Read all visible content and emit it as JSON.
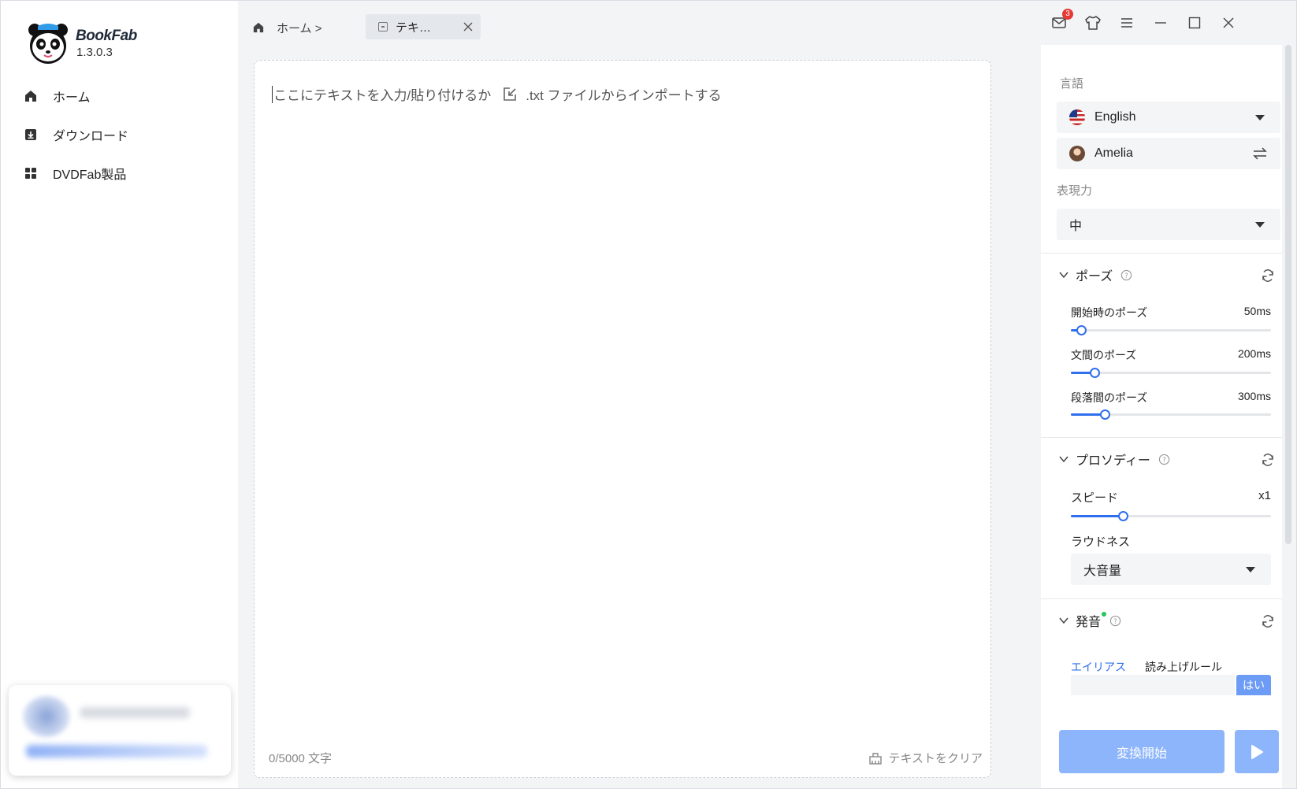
{
  "app": {
    "name": "BookFab",
    "version": "1.3.0.3"
  },
  "sidebar": {
    "items": [
      {
        "label": "ホーム",
        "icon": "home-icon"
      },
      {
        "label": "ダウンロード",
        "icon": "download-icon"
      },
      {
        "label": "DVDFab製品",
        "icon": "grid-icon"
      }
    ]
  },
  "header": {
    "breadcrumb": "ホーム >",
    "tab_label": "テキ…",
    "notification_count": "3",
    "icons": [
      "mail-icon",
      "shirt-icon",
      "menu-icon",
      "minimize-icon",
      "maximize-icon",
      "close-icon"
    ]
  },
  "editor": {
    "placeholder_text": "ここにテキストを入力/貼り付けるか",
    "import_text": ".txt ファイルからインポートする",
    "char_count": "0/5000 文字",
    "clear_label": "テキストをクリア"
  },
  "panel": {
    "language_label": "言語",
    "language_value": "English",
    "voice_value": "Amelia",
    "expressiveness_label": "表現力",
    "expressiveness_value": "中",
    "pause": {
      "title": "ポーズ",
      "items": [
        {
          "label": "開始時のポーズ",
          "value": "50ms",
          "fraction": 0.05
        },
        {
          "label": "文間のポーズ",
          "value": "200ms",
          "fraction": 0.12
        },
        {
          "label": "段落間のポーズ",
          "value": "300ms",
          "fraction": 0.17
        }
      ]
    },
    "prosody": {
      "title": "プロソディー",
      "speed_label": "スピード",
      "speed_value": "x1",
      "speed_fraction": 0.26,
      "loudness_label": "ラウドネス",
      "loudness_value": "大音量"
    },
    "pronunciation": {
      "title": "発音",
      "tab_alias": "エイリアス",
      "tab_rules": "読み上げルール",
      "yes_button": "はい"
    },
    "convert_label": "変換開始"
  },
  "colors": {
    "accent": "#2f6fed",
    "button": "#8db5fb",
    "badge": "#e53935"
  }
}
